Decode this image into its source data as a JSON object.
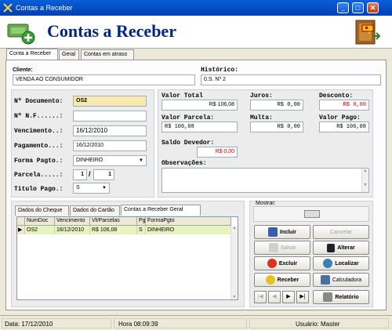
{
  "window": {
    "title": "Contas a Receber",
    "header_title": "Contas a Receber"
  },
  "tabs": [
    "Conta a Receber",
    "Geral",
    "Contas em atraso"
  ],
  "form": {
    "cliente_label": "Cliente:",
    "cliente_value": "VENDA AO CONSUMIDOR",
    "historico_label": "Histórico:",
    "historico_value": "0.S. Nº 2",
    "documento_label": "Nº Documento:",
    "documento_value": "OS2",
    "nf_label": "Nº N.F......:",
    "nf_value": "",
    "vencimento_label": "Vencimento..:",
    "vencimento_value": "16/12/2010",
    "pagamento_label": "Pagamento...:",
    "pagamento_value": "16/12/2010",
    "forma_label": "Forma Pagto.:",
    "forma_value": "DINHEIRO",
    "parcela_label": "Parcela.....:",
    "parcela_num": "1",
    "parcela_sep": "/",
    "parcela_total": "1",
    "titulo_label": "Titulo Pago.:",
    "titulo_value": "S"
  },
  "values": {
    "valor_total_label": "Valor Total",
    "valor_total": "R$ 106,08",
    "juros_label": "Juros:",
    "juros": "R$ 0,00",
    "desconto_label": "Desconto:",
    "desconto": "R$ 0,00",
    "valor_parcela_label": "Valor Parcela:",
    "valor_parcela": "R$ 106,08",
    "multa_label": "Multa:",
    "multa": "R$ 0,00",
    "valor_pago_label": "Valor Pago:",
    "valor_pago": "R$ 106,08",
    "saldo_label": "Saldo Devedor:",
    "saldo": "R$ 0,00",
    "obs_label": "Observações:",
    "obs_value": ""
  },
  "subtabs": [
    "Dados do Cheque",
    "Dados do Cartão",
    "Contas a Receber Geral"
  ],
  "grid": {
    "columns": [
      "NumDoc",
      "Vencimento",
      "VlrParcelas",
      "Pg",
      "FormaPgto"
    ],
    "rows": [
      [
        "OS2",
        "16/12/2010",
        "R$ 106,08",
        "S",
        "DINHEIRO"
      ]
    ],
    "row_marker": "▶"
  },
  "mostrar": {
    "label": "Mostrar:"
  },
  "buttons": {
    "incluir": "Incluir",
    "cancelar": "Cancelar",
    "salvar": "Salvar",
    "alterar": "Alterar",
    "excluir": "Excluir",
    "localizar": "Localizar",
    "receber": "Receber",
    "calculadora": "Calculadora",
    "relatorio": "Relatório"
  },
  "nav": [
    "|◀",
    "◀",
    "▶",
    "▶|"
  ],
  "statusbar": {
    "data": "Data: 17/12/2010",
    "hora": "Hora 08:09:39",
    "usuario": "Usuário: Master"
  },
  "colors": {
    "titlebar": "#0a5fd8",
    "header_text": "#002680",
    "required_field": "#f7e9b0",
    "zero_value": "#e00000",
    "selected_row": "#e8f4c0"
  }
}
